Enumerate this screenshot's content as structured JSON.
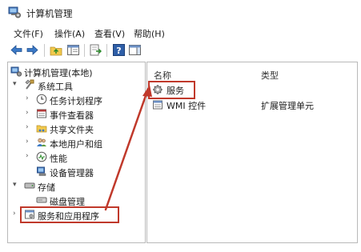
{
  "window": {
    "title": "计算机管理"
  },
  "menu": [
    {
      "label": "文件(F)"
    },
    {
      "label": "操作(A)"
    },
    {
      "label": "查看(V)"
    },
    {
      "label": "帮助(H)"
    }
  ],
  "tree": {
    "root": "计算机管理(本地)",
    "system_tools": "系统工具",
    "task_scheduler": "任务计划程序",
    "event_viewer": "事件查看器",
    "shared_folders": "共享文件夹",
    "local_users": "本地用户和组",
    "performance": "性能",
    "device_manager": "设备管理器",
    "storage": "存储",
    "disk_management": "磁盘管理",
    "services_apps": "服务和应用程序"
  },
  "list": {
    "col_name": "名称",
    "col_type": "类型",
    "rows": [
      {
        "name": "服务",
        "type": ""
      },
      {
        "name": "WMI 控件",
        "type": "扩展管理单元"
      }
    ]
  },
  "colors": {
    "highlight": "#c0392b",
    "selected_bg": "#cde8ff"
  }
}
